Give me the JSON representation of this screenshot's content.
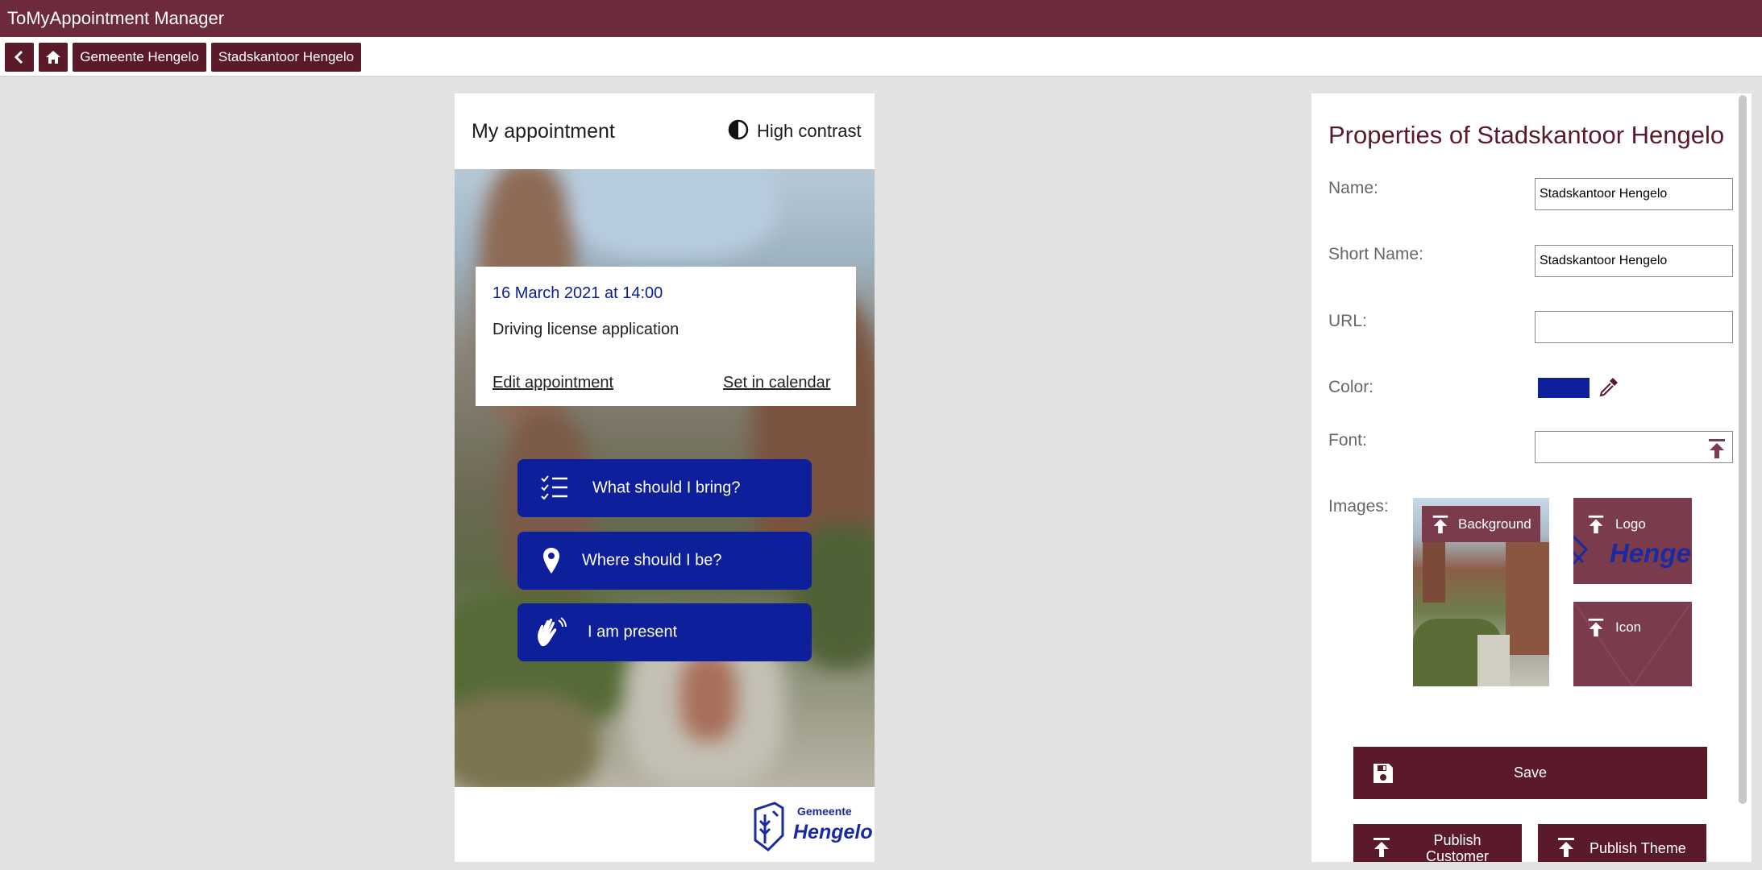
{
  "app": {
    "title": "ToMyAppointment Manager"
  },
  "nav": {
    "back_icon": "chevron-left-icon",
    "home_icon": "home-icon",
    "breadcrumbs": [
      "Gemeente Hengelo",
      "Stadskantoor Hengelo"
    ]
  },
  "preview": {
    "title": "My appointment",
    "high_contrast_label": "High contrast",
    "high_contrast_icon": "contrast-icon",
    "appointment": {
      "date": "16 March 2021 at 14:00",
      "type": "Driving license application",
      "edit_link": "Edit appointment",
      "calendar_link": "Set in calendar"
    },
    "actions": [
      {
        "label": "What should I bring?",
        "icon": "checklist-icon"
      },
      {
        "label": "Where should I be?",
        "icon": "map-pin-icon"
      },
      {
        "label": "I am present",
        "icon": "waving-hand-icon"
      }
    ],
    "brand": {
      "small": "Gemeente",
      "big": "Hengelo"
    },
    "accent_color": "#0e1f9b"
  },
  "properties": {
    "title": "Properties of Stadskantoor Hengelo",
    "name_label": "Name:",
    "name_value": "Stadskantoor Hengelo",
    "short_name_label": "Short Name:",
    "short_name_value": "Stadskantoor Hengelo",
    "url_label": "URL:",
    "url_value": "",
    "color_label": "Color:",
    "color_value": "#0e1f9b",
    "font_label": "Font:",
    "font_value": "",
    "images_label": "Images:",
    "image_buttons": {
      "background": "Background",
      "logo": "Logo",
      "icon": "Icon"
    },
    "save_label": "Save",
    "publish_customer_label": "Publish Customer",
    "publish_theme_label": "Publish Theme"
  },
  "colors": {
    "brand": "#6d2a3c",
    "brand_dark": "#5b1a2a",
    "accent": "#0e1f9b"
  }
}
